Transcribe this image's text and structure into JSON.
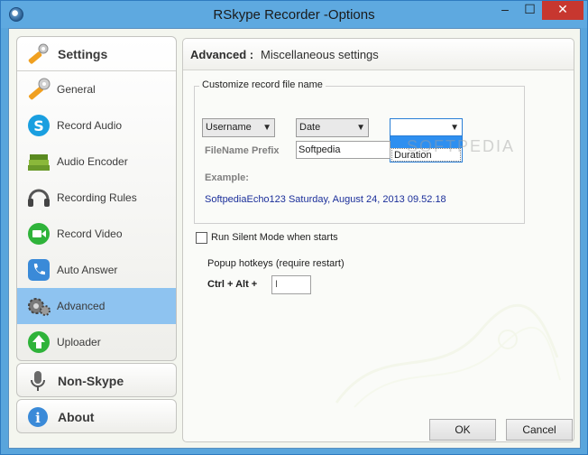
{
  "window": {
    "title": "RSkype Recorder -Options",
    "controls": {
      "minimize": "–",
      "maximize": "☐",
      "close": "✕"
    }
  },
  "nav": {
    "settings_header": "Settings",
    "items": [
      {
        "label": "General",
        "icon": "wrench-icon"
      },
      {
        "label": "Record Audio",
        "icon": "skype-icon"
      },
      {
        "label": "Audio Encoder",
        "icon": "books-icon"
      },
      {
        "label": "Recording Rules",
        "icon": "headset-icon"
      },
      {
        "label": "Record Video",
        "icon": "video-camera-icon"
      },
      {
        "label": "Auto Answer",
        "icon": "phone-icon"
      },
      {
        "label": "Advanced",
        "icon": "gears-icon",
        "selected": true
      },
      {
        "label": "Uploader",
        "icon": "upload-arrow-icon"
      }
    ],
    "nonskype_header": "Non-Skype",
    "about_header": "About"
  },
  "panel": {
    "header_strong": "Advanced :",
    "header_rest": "Miscellaneous settings",
    "group_title": "Customize record file name",
    "combo1_value": "Username",
    "combo2_value": "Date",
    "combo3_value": "",
    "combo3_options": [
      "",
      "Duration"
    ],
    "filename_prefix_label": "FileName Prefix",
    "filename_prefix_value": "Softpedia",
    "example_label": "Example:",
    "example_value": "SoftpediaEcho123  Saturday, August 24, 2013 09.52.18",
    "silent_mode_label": "Run Silent Mode when starts",
    "silent_mode_checked": false,
    "hotkeys_title": "Popup hotkeys (require restart)",
    "hotkeys_prefix": "Ctrl + Alt +",
    "hotkey_value": "I"
  },
  "buttons": {
    "ok": "OK",
    "cancel": "Cancel"
  },
  "watermark": "SOFTPEDIA",
  "colors": {
    "accent": "#59a5dc",
    "selected": "#8ec3f0",
    "close": "#c7372f",
    "link": "#1b2f9a"
  }
}
